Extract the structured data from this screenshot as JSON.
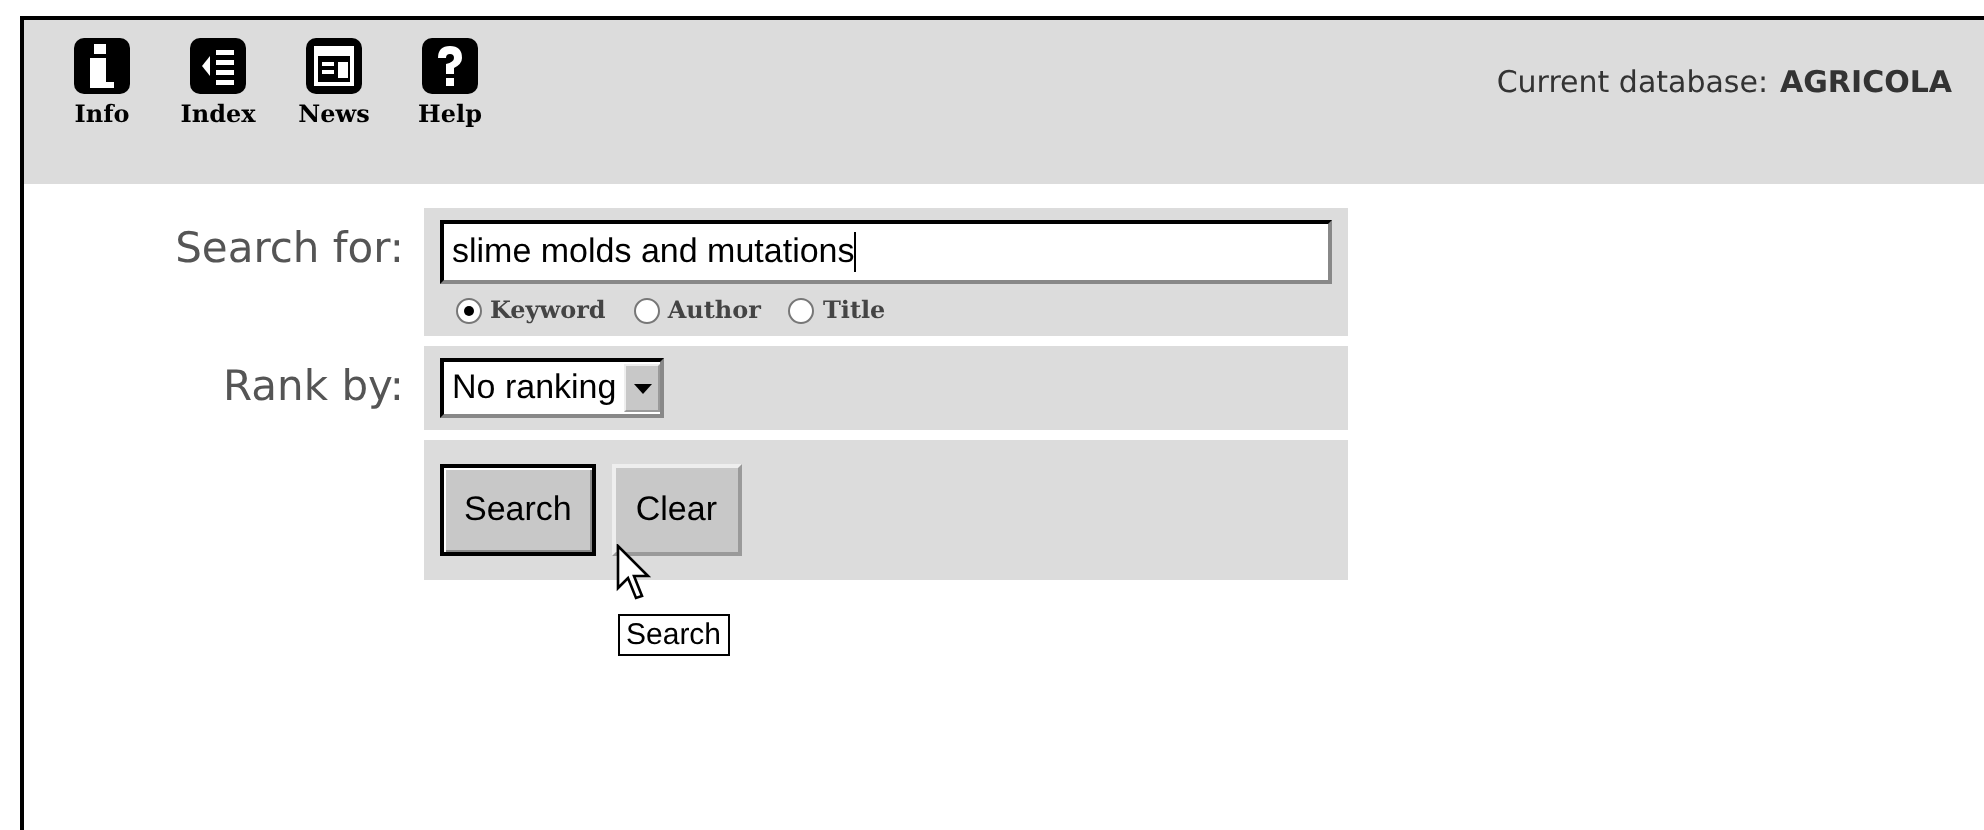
{
  "toolbar": {
    "items": [
      {
        "kind": "info",
        "label": "Info"
      },
      {
        "kind": "index",
        "label": "Index"
      },
      {
        "kind": "news",
        "label": "News"
      },
      {
        "kind": "help",
        "label": "Help"
      }
    ],
    "database_label": "Current database:",
    "database_name": "AGRICOLA"
  },
  "search": {
    "label": "Search for:",
    "value": "slime molds and mutations",
    "options": [
      {
        "label": "Keyword",
        "selected": true
      },
      {
        "label": "Author",
        "selected": false
      },
      {
        "label": "Title",
        "selected": false
      }
    ]
  },
  "rank": {
    "label": "Rank by:",
    "value": "No ranking"
  },
  "buttons": [
    {
      "label": "Search",
      "focused": true
    },
    {
      "label": "Clear",
      "focused": false
    }
  ],
  "tooltip": "Search"
}
